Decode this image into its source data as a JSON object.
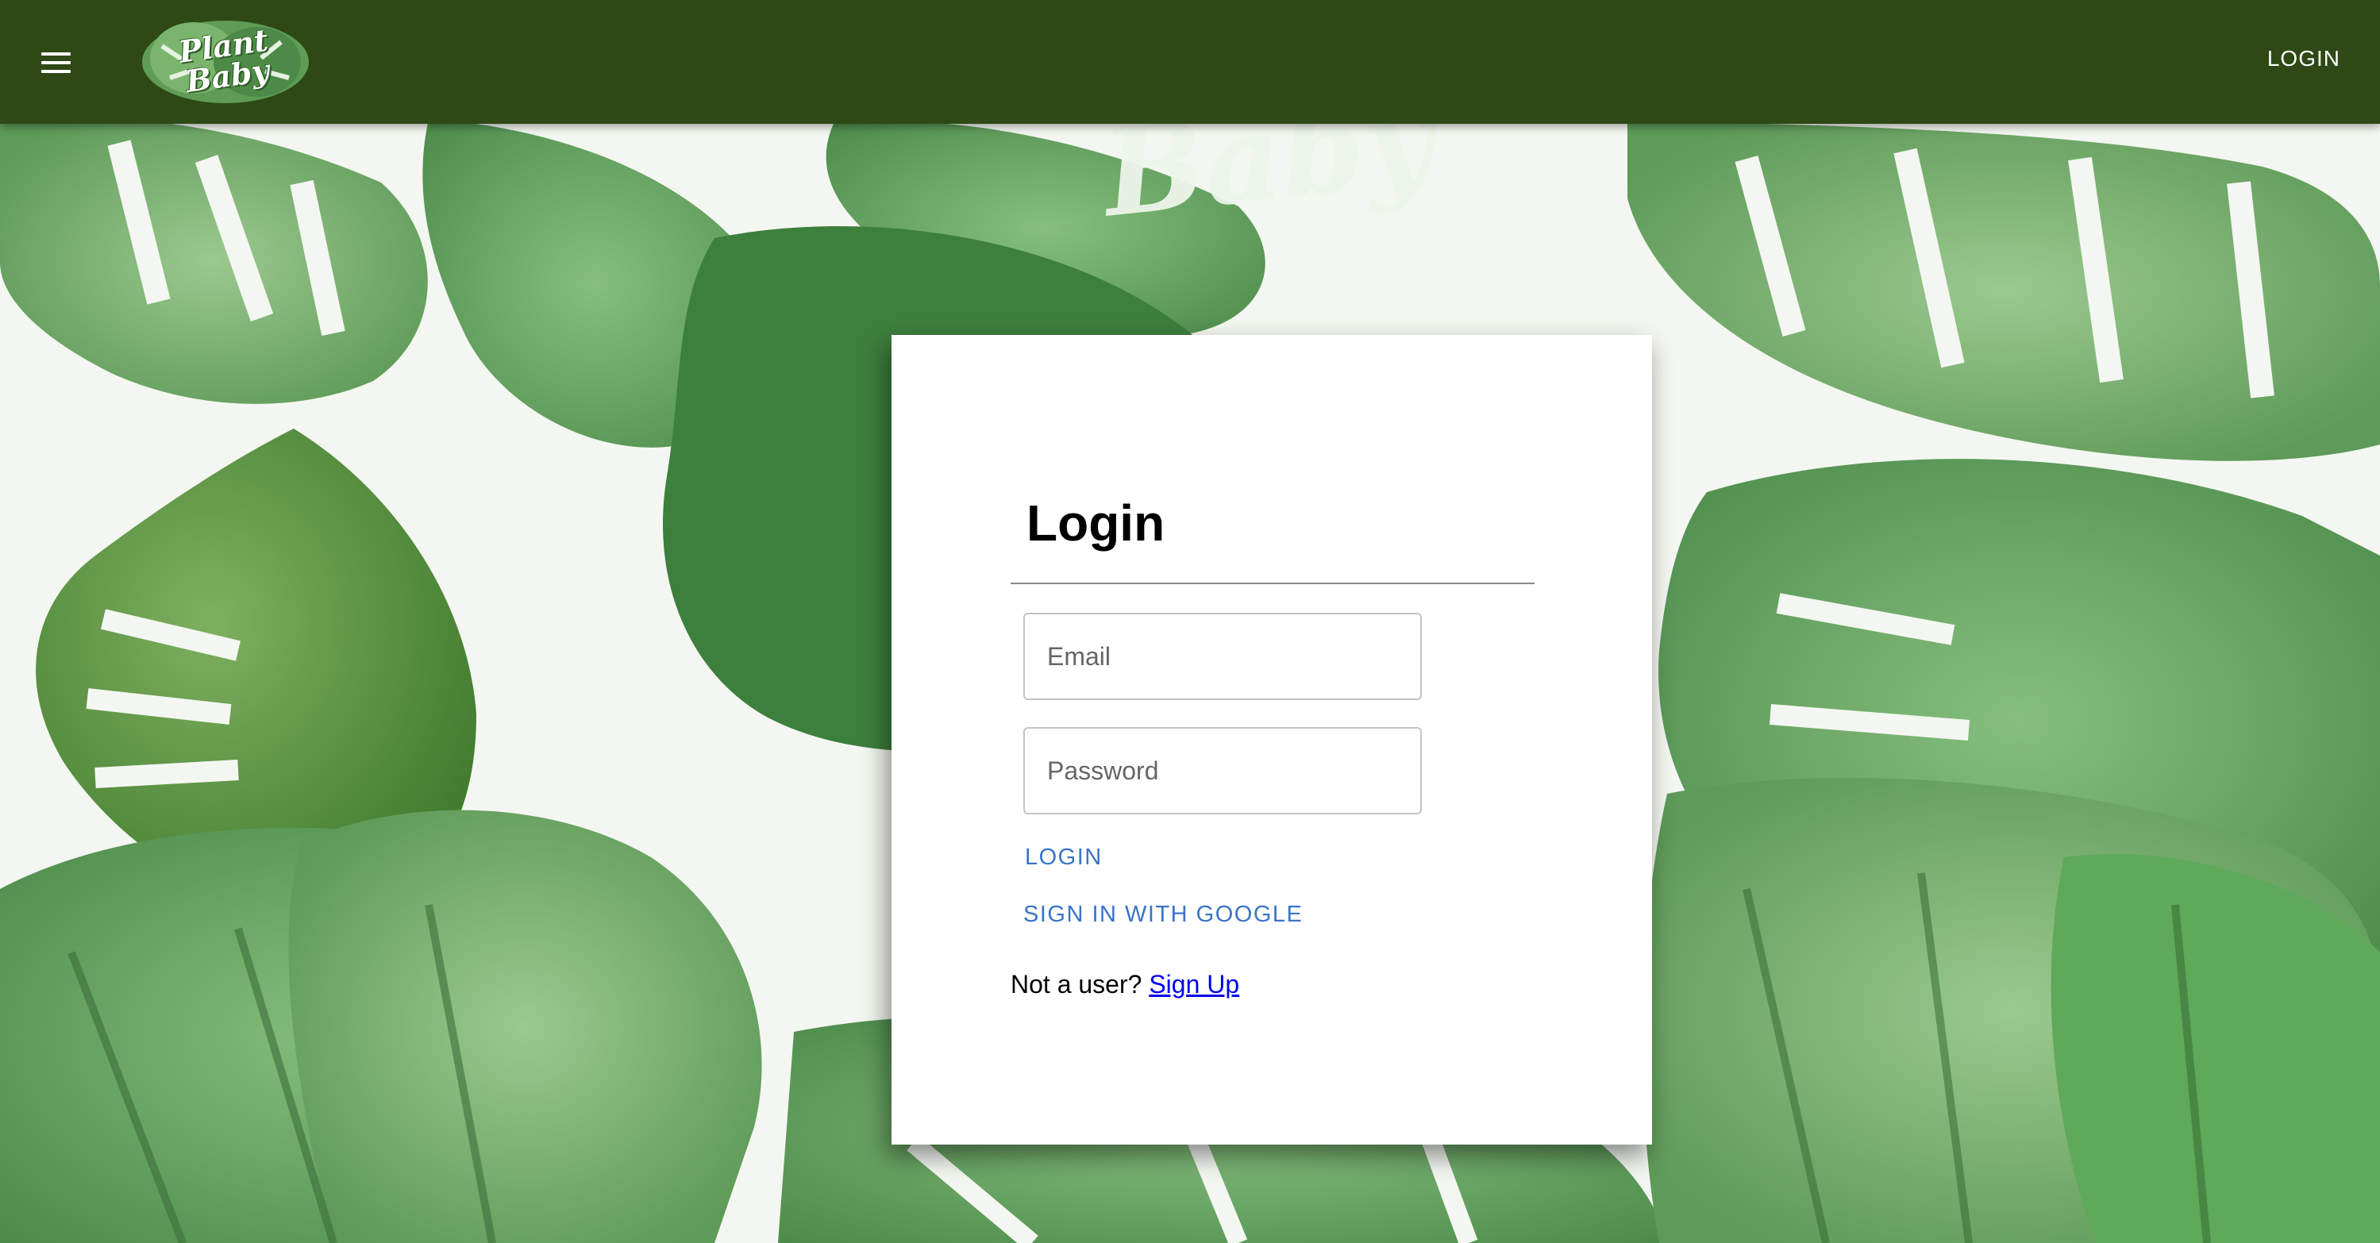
{
  "header": {
    "menu_icon": "hamburger-menu-icon",
    "logo_line1": "Plant",
    "logo_line2": "Baby",
    "nav_login": "LOGIN"
  },
  "login_card": {
    "title": "Login",
    "email_placeholder": "Email",
    "email_value": "",
    "password_placeholder": "Password",
    "password_value": "",
    "login_button": "LOGIN",
    "google_button": "SIGN IN WITH GOOGLE",
    "signup_prompt": "Not a user?",
    "signup_link": "Sign Up"
  },
  "colors": {
    "appbar": "#2e4915",
    "accent": "#3a74c8",
    "link": "#0000ee",
    "leaf_dark": "#4f8a45",
    "leaf_light": "#8fc08a"
  }
}
